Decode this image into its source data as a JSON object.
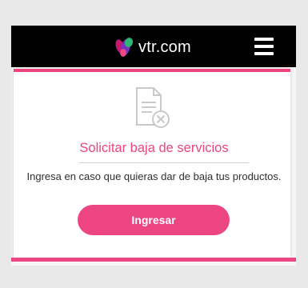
{
  "header": {
    "logo_text": "vtr.com",
    "logo_icon": "vtr-logo-icon",
    "menu_icon": "hamburger-menu-icon"
  },
  "card": {
    "icon": "document-cancel-icon",
    "title": "Solicitar baja de servicios",
    "description": "Ingresa en caso que quieras dar de baja tus productos.",
    "button_label": "Ingresar"
  },
  "colors": {
    "accent": "#ed4582",
    "header_bg": "#000000",
    "background": "#e9e9e9"
  }
}
